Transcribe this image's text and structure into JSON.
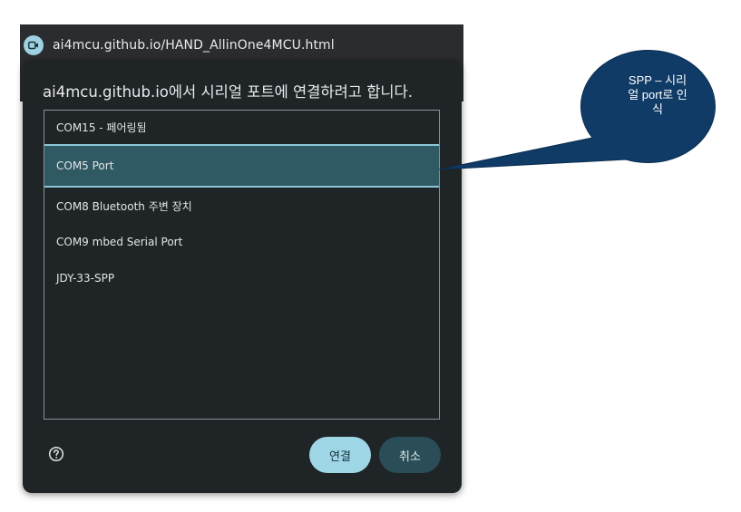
{
  "browser": {
    "site_url": "ai4mcu.github.io/HAND_AllinOne4MCU.html",
    "site_icon": "camera-icon"
  },
  "dialog": {
    "title": "ai4mcu.github.io에서 시리얼 포트에 연결하려고 합니다.",
    "ports": [
      {
        "label": "COM15 - 페어링됨",
        "selected": false
      },
      {
        "label": "COM5 Port",
        "selected": true
      },
      {
        "label": "COM8 Bluetooth 주변 장치",
        "selected": false
      },
      {
        "label": "COM9 mbed Serial Port",
        "selected": false
      },
      {
        "label": "JDY-33-SPP",
        "selected": false
      }
    ],
    "help_icon": "question-circle-icon",
    "connect_label": "연결",
    "cancel_label": "취소"
  },
  "callout": {
    "line1": "SPP – 시리",
    "line2": "얼 port로 인",
    "line3": "식",
    "fill_color": "#0f3b66"
  }
}
